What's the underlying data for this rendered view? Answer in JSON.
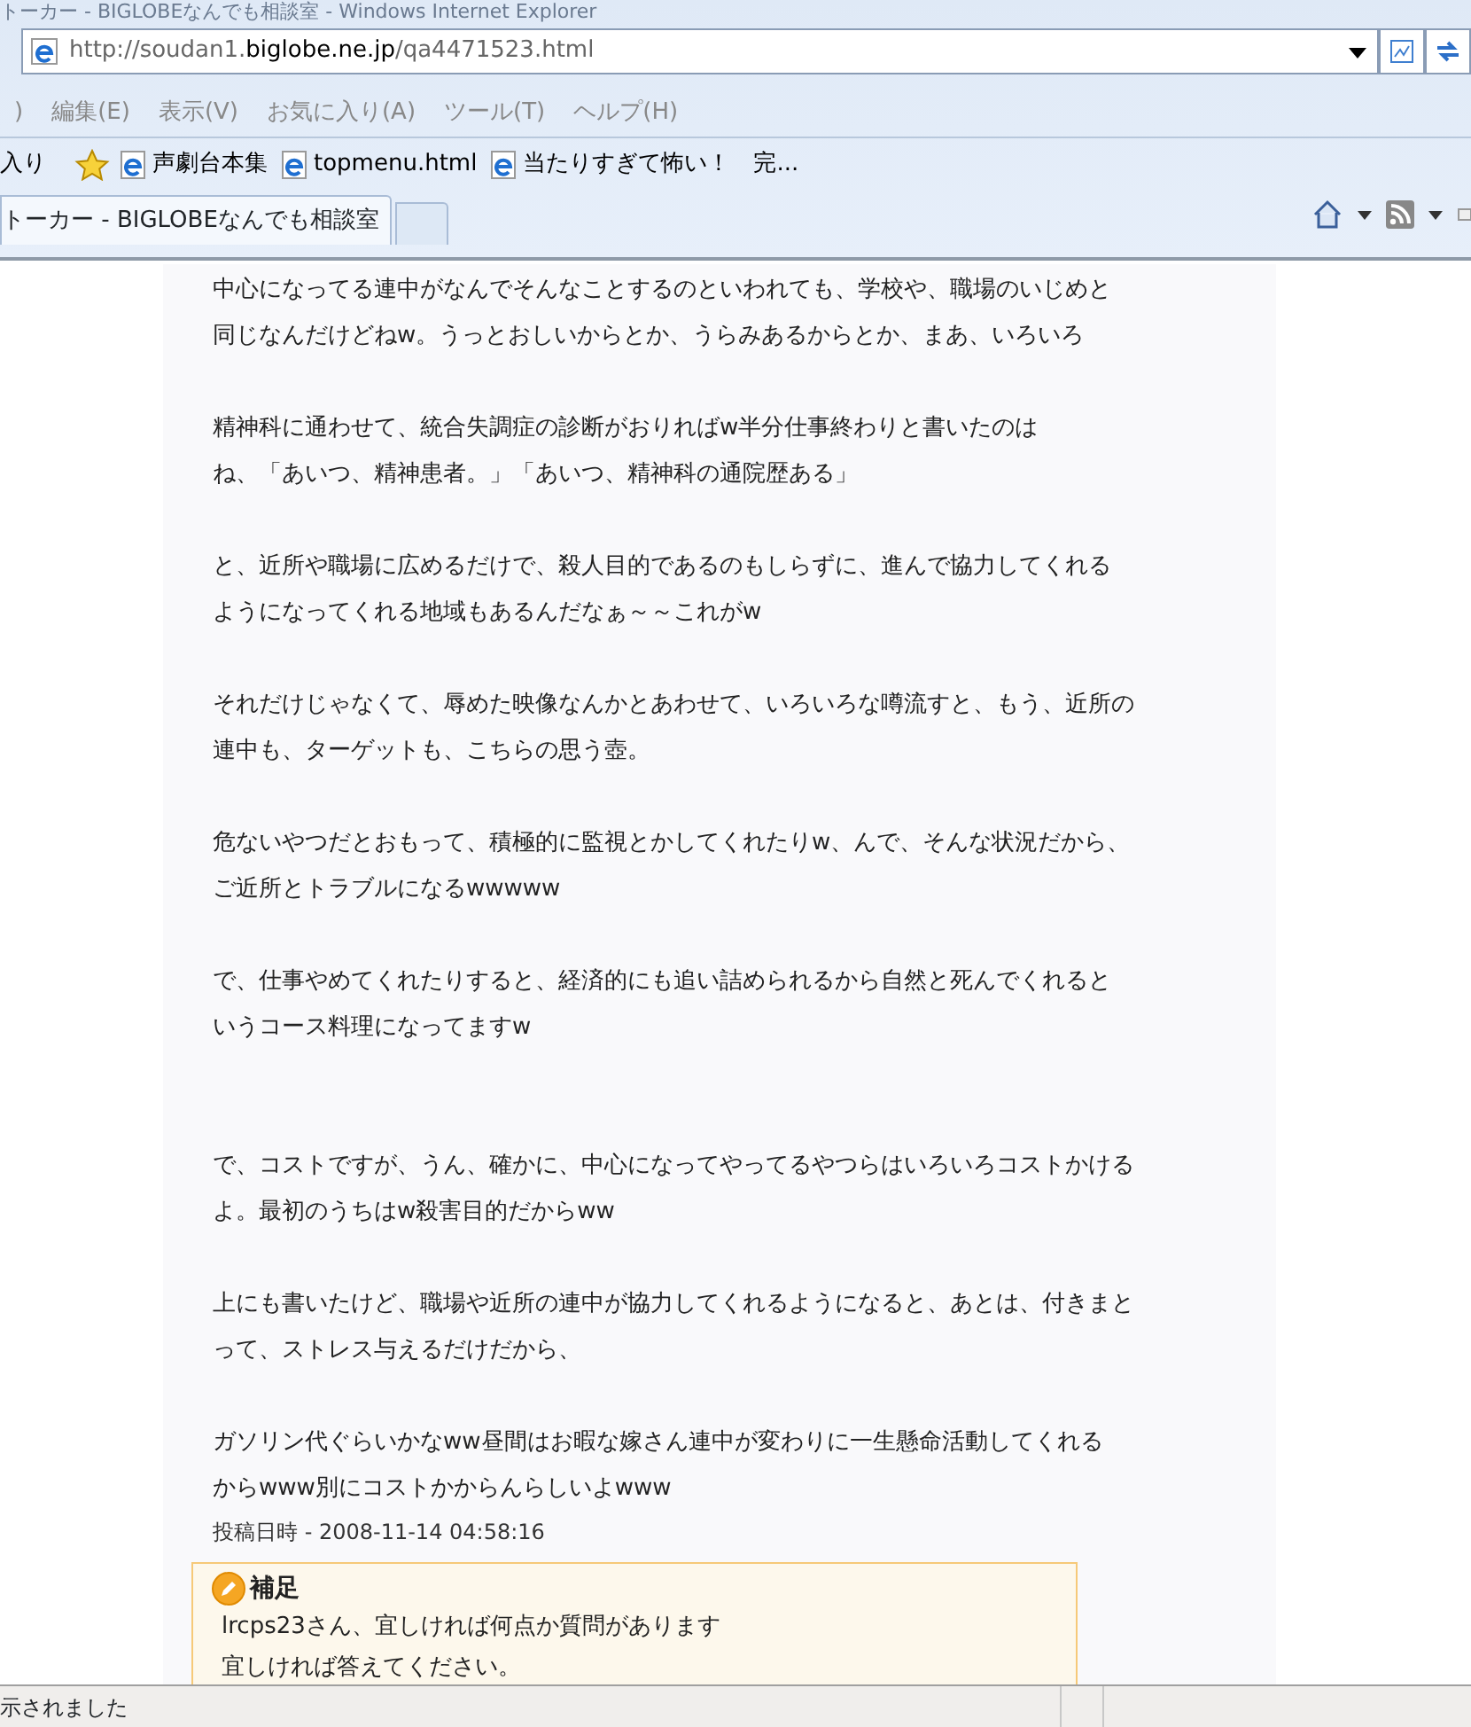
{
  "window": {
    "title": "トーカー - BIGLOBEなんでも相談室 - Windows Internet Explorer"
  },
  "address_bar": {
    "url_parts": [
      {
        "text": "http://soudan1.",
        "emphasis": false
      },
      {
        "text": "biglobe.ne.jp",
        "emphasis": true
      },
      {
        "text": "/qa4471523.html",
        "emphasis": false
      }
    ]
  },
  "menu": [
    ")",
    "編集(E)",
    "表示(V)",
    "お気に入り(A)",
    "ツール(T)",
    "ヘルプ(H)"
  ],
  "favorites_bar": {
    "label": "入り",
    "links": [
      "声劇台本集",
      "topmenu.html",
      "当たりすぎて怖い！　完..."
    ]
  },
  "tabs": [
    {
      "label": "トーカー - BIGLOBEなんでも相談室",
      "selected": true
    },
    {
      "selected": false
    }
  ],
  "post": {
    "paragraphs": [
      {
        "kind": "text",
        "lines": [
          "中心になってる連中がなんでそんなことするのといわれても、学校や、職場のいじめと",
          "同じなんだけどねw。うっとおしいからとか、うらみあるからとか、まあ、いろいろ"
        ]
      },
      {
        "kind": "text",
        "lines": [
          "精神科に通わせて、統合失調症の診断がおりればw半分仕事終わりと書いたのは",
          "ね、「あいつ、精神患者。」「あいつ、精神科の通院歴ある」"
        ]
      },
      {
        "kind": "text",
        "lines": [
          "と、近所や職場に広めるだけで、殺人目的であるのもしらずに、進んで協力してくれる",
          "ようになってくれる地域もあるんだなぁ～～これがw"
        ]
      },
      {
        "kind": "text",
        "lines": [
          "それだけじゃなくて、辱めた映像なんかとあわせて、いろいろな噂流すと、もう、近所の",
          "連中も、ターゲットも、こちらの思う壺。"
        ]
      },
      {
        "kind": "text",
        "lines": [
          "危ないやつだとおもって、積極的に監視とかしてくれたりw、んで、そんな状況だから、",
          "ご近所とトラブルになるwwwww"
        ]
      },
      {
        "kind": "text",
        "lines": [
          "で、仕事やめてくれたりすると、経済的にも追い詰められるから自然と死んでくれると",
          "いうコース料理になってますw"
        ]
      },
      {
        "kind": "blank_line"
      },
      {
        "kind": "text",
        "lines": [
          "で、コストですが、うん、確かに、中心になってやってるやつらはいろいろコストかける",
          "よ。最初のうちはw殺害目的だからww"
        ]
      },
      {
        "kind": "text",
        "lines": [
          "上にも書いたけど、職場や近所の連中が協力してくれるようになると、あとは、付きまと",
          "って、ストレス与えるだけだから、"
        ]
      },
      {
        "kind": "text",
        "lines": [
          "ガソリン代ぐらいかなww昼間はお暇な嫁さん連中が変わりに一生懸命活動してくれる",
          "からwww別にコストかからんらしいよwww"
        ]
      }
    ],
    "posted": "投稿日時 - 2008-11-14 04:58:16"
  },
  "supplement": {
    "title": "補足",
    "lines": [
      "lrcps23さん、宜しければ何点か質問があります",
      "宜しければ答えてください。"
    ]
  },
  "status_bar": {
    "text": "示されました"
  }
}
